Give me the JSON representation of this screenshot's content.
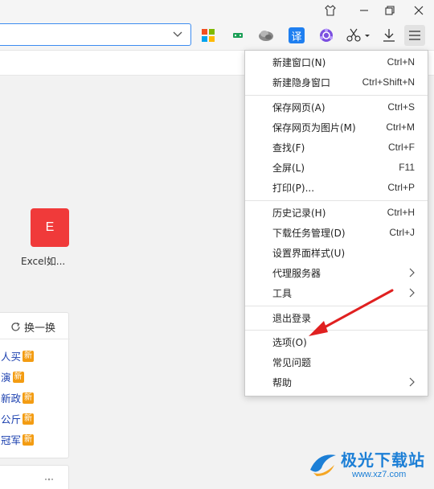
{
  "toolbar": {
    "translate_label": "译"
  },
  "tile": {
    "letter": "E",
    "label": "Excel如..."
  },
  "hot": {
    "refresh_label": "换一换",
    "badge": "新",
    "items": [
      "人买",
      "演",
      "新政",
      "公斤",
      "冠军"
    ]
  },
  "menu": {
    "items": [
      {
        "label": "新建窗口(N)",
        "shortcut": "Ctrl+N"
      },
      {
        "label": "新建隐身窗口",
        "shortcut": "Ctrl+Shift+N"
      },
      {
        "label": "保存网页(A)",
        "shortcut": "Ctrl+S"
      },
      {
        "label": "保存网页为图片(M)",
        "shortcut": "Ctrl+M"
      },
      {
        "label": "查找(F)",
        "shortcut": "Ctrl+F"
      },
      {
        "label": "全屏(L)",
        "shortcut": "F11"
      },
      {
        "label": "打印(P)...",
        "shortcut": "Ctrl+P"
      },
      {
        "label": "历史记录(H)",
        "shortcut": "Ctrl+H"
      },
      {
        "label": "下载任务管理(D)",
        "shortcut": "Ctrl+J"
      },
      {
        "label": "设置界面样式(U)",
        "shortcut": ""
      },
      {
        "label": "代理服务器",
        "shortcut": ""
      },
      {
        "label": "工具",
        "shortcut": ""
      },
      {
        "label": "退出登录",
        "shortcut": ""
      },
      {
        "label": "选项(O)",
        "shortcut": ""
      },
      {
        "label": "常见问题",
        "shortcut": ""
      },
      {
        "label": "帮助",
        "shortcut": ""
      }
    ]
  },
  "watermark": {
    "name": "极光下载站",
    "url": "www.xz7.com"
  },
  "colors": {
    "accent": "#3c8cf0",
    "annotation_arrow": "#e02020",
    "badge": "#f39c12",
    "tile": "#f03a3a"
  }
}
